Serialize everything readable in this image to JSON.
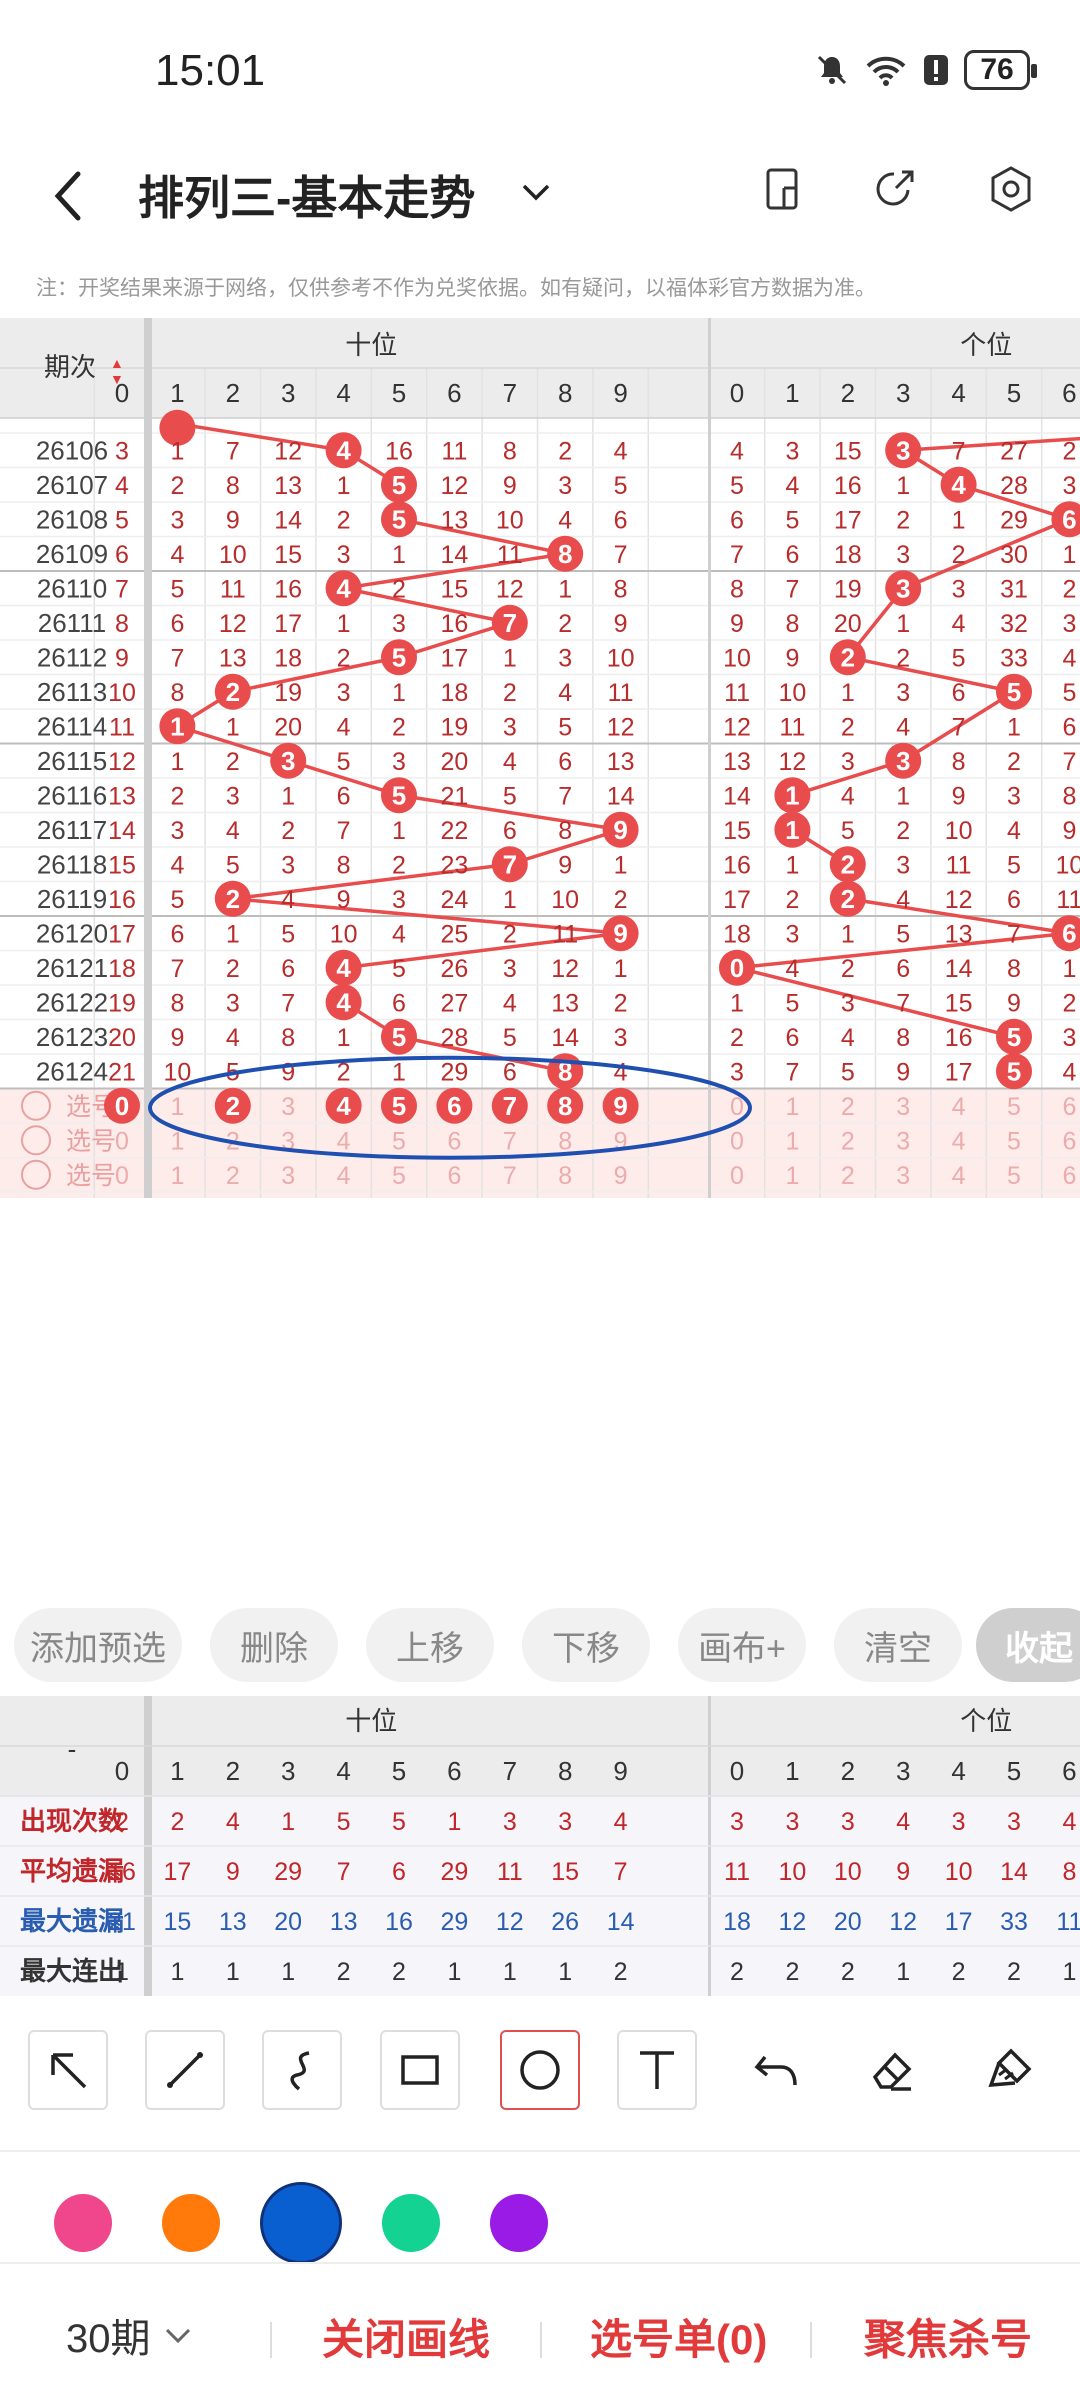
{
  "status_bar": {
    "time": "15:01",
    "battery": "76"
  },
  "header": {
    "title": "排列三-基本走势"
  },
  "notice": "注：开奖结果来源于网络，仅供参考不作为兑奖依据。如有疑问，以福体彩官方数据为准。",
  "table": {
    "period_header": "期次",
    "groups": [
      "十位",
      "个位"
    ],
    "digits": [
      "0",
      "1",
      "2",
      "3",
      "4",
      "5",
      "6",
      "7",
      "8",
      "9"
    ],
    "rows": [
      {
        "p": "26106",
        "t": [
          3,
          1,
          7,
          12,
          "4",
          16,
          11,
          8,
          2,
          4
        ],
        "g": [
          4,
          3,
          15,
          "3",
          7,
          27,
          2
        ]
      },
      {
        "p": "26107",
        "t": [
          4,
          2,
          8,
          13,
          1,
          "5",
          12,
          9,
          3,
          5
        ],
        "g": [
          5,
          4,
          16,
          1,
          "4",
          28,
          3
        ]
      },
      {
        "p": "26108",
        "t": [
          5,
          3,
          9,
          14,
          2,
          "5",
          13,
          10,
          4,
          6
        ],
        "g": [
          6,
          5,
          17,
          2,
          1,
          29,
          "6"
        ]
      },
      {
        "p": "26109",
        "t": [
          6,
          4,
          10,
          15,
          3,
          1,
          14,
          11,
          "8",
          7
        ],
        "g": [
          7,
          6,
          18,
          3,
          2,
          30,
          1
        ]
      },
      {
        "p": "26110",
        "t": [
          7,
          5,
          11,
          16,
          "4",
          2,
          15,
          12,
          1,
          8
        ],
        "g": [
          8,
          7,
          19,
          "3",
          3,
          31,
          2
        ]
      },
      {
        "p": "26111",
        "t": [
          8,
          6,
          12,
          17,
          1,
          3,
          16,
          "7",
          2,
          9
        ],
        "g": [
          9,
          8,
          20,
          1,
          4,
          32,
          3
        ]
      },
      {
        "p": "26112",
        "t": [
          9,
          7,
          13,
          18,
          2,
          "5",
          17,
          1,
          3,
          10
        ],
        "g": [
          10,
          9,
          "2",
          2,
          5,
          33,
          4
        ]
      },
      {
        "p": "26113",
        "t": [
          10,
          8,
          "2",
          19,
          3,
          1,
          18,
          2,
          4,
          11
        ],
        "g": [
          11,
          10,
          1,
          3,
          6,
          "5",
          5
        ]
      },
      {
        "p": "26114",
        "t": [
          11,
          "1",
          1,
          20,
          4,
          2,
          19,
          3,
          5,
          12
        ],
        "g": [
          12,
          11,
          2,
          4,
          7,
          1,
          6
        ]
      },
      {
        "p": "26115",
        "t": [
          12,
          1,
          2,
          "3",
          5,
          3,
          20,
          4,
          6,
          13
        ],
        "g": [
          13,
          12,
          3,
          "3",
          8,
          2,
          7
        ]
      },
      {
        "p": "26116",
        "t": [
          13,
          2,
          3,
          1,
          6,
          "5",
          21,
          5,
          7,
          14
        ],
        "g": [
          14,
          "1",
          4,
          1,
          9,
          3,
          8
        ]
      },
      {
        "p": "26117",
        "t": [
          14,
          3,
          4,
          2,
          7,
          1,
          22,
          6,
          8,
          "9"
        ],
        "g": [
          15,
          "1",
          5,
          2,
          10,
          4,
          9
        ]
      },
      {
        "p": "26118",
        "t": [
          15,
          4,
          5,
          3,
          8,
          2,
          23,
          "7",
          9,
          1
        ],
        "g": [
          16,
          1,
          "2",
          3,
          11,
          5,
          10
        ]
      },
      {
        "p": "26119",
        "t": [
          16,
          5,
          "2",
          4,
          9,
          3,
          24,
          1,
          10,
          2
        ],
        "g": [
          17,
          2,
          "2",
          4,
          12,
          6,
          11
        ]
      },
      {
        "p": "26120",
        "t": [
          17,
          6,
          1,
          5,
          10,
          4,
          25,
          2,
          11,
          "9"
        ],
        "g": [
          18,
          3,
          1,
          5,
          13,
          7,
          "6"
        ]
      },
      {
        "p": "26121",
        "t": [
          18,
          7,
          2,
          6,
          "4",
          5,
          26,
          3,
          12,
          1
        ],
        "g": [
          "0",
          4,
          2,
          6,
          14,
          8,
          1
        ]
      },
      {
        "p": "26122",
        "t": [
          19,
          8,
          3,
          7,
          "4",
          6,
          27,
          4,
          13,
          2
        ],
        "g": [
          1,
          5,
          3,
          7,
          15,
          9,
          2
        ]
      },
      {
        "p": "26123",
        "t": [
          20,
          9,
          4,
          8,
          1,
          "5",
          28,
          5,
          14,
          3
        ],
        "g": [
          2,
          6,
          4,
          8,
          16,
          "5",
          3
        ]
      },
      {
        "p": "26124",
        "t": [
          21,
          10,
          5,
          9,
          2,
          1,
          29,
          6,
          "8",
          4
        ],
        "g": [
          3,
          7,
          5,
          9,
          17,
          "5",
          4
        ]
      }
    ],
    "select_label": "选号",
    "selected_tens": [
      "0",
      "2",
      "4",
      "5",
      "6",
      "7",
      "8",
      "9"
    ]
  },
  "actions": [
    "添加预选",
    "删除",
    "上移",
    "下移",
    "画布+",
    "清空",
    "收起"
  ],
  "stats": {
    "header": "-",
    "rows": [
      {
        "label": "出现次数",
        "color": "#c0262a",
        "t": [
          2,
          2,
          4,
          1,
          5,
          5,
          1,
          3,
          3,
          4
        ],
        "g": [
          3,
          3,
          3,
          4,
          3,
          3,
          4
        ]
      },
      {
        "label": "平均遗漏",
        "color": "#c0262a",
        "t": [
          16,
          17,
          9,
          29,
          7,
          6,
          29,
          11,
          15,
          7
        ],
        "g": [
          11,
          10,
          10,
          9,
          10,
          14,
          8
        ]
      },
      {
        "label": "最大遗漏",
        "color": "#2a5db0",
        "t": [
          21,
          15,
          13,
          20,
          13,
          16,
          29,
          12,
          26,
          14
        ],
        "g": [
          18,
          12,
          20,
          12,
          17,
          33,
          11
        ]
      },
      {
        "label": "最大连出",
        "color": "#333",
        "t": [
          1,
          1,
          1,
          1,
          2,
          2,
          1,
          1,
          1,
          2
        ],
        "g": [
          2,
          2,
          2,
          1,
          2,
          2,
          1
        ]
      }
    ]
  },
  "palette": {
    "pink": "#f0468c",
    "orange": "#ff7a0a",
    "blue": "#0a5fd0",
    "green": "#14d291",
    "purple": "#9a1ae6",
    "line_red": "#e84c4c",
    "ellipse_blue": "#1f4fb0"
  },
  "bottom": {
    "period": "30期",
    "close_line": "关闭画线",
    "pick_list": "选号单(0)",
    "focus_kill": "聚焦杀号"
  }
}
